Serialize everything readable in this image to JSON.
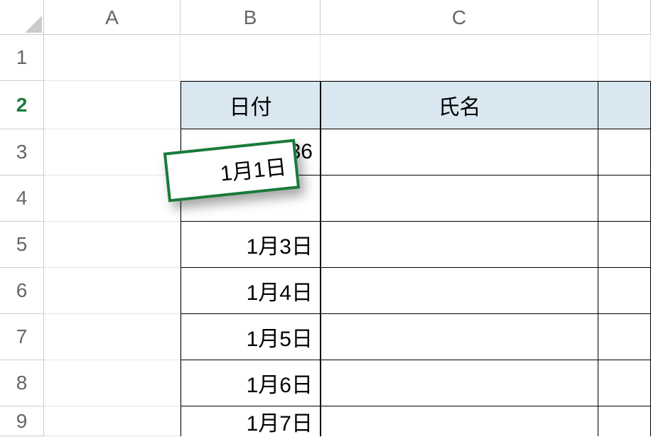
{
  "columns": [
    "A",
    "B",
    "C"
  ],
  "rows": [
    "1",
    "2",
    "3",
    "4",
    "5",
    "6",
    "7",
    "8",
    "9"
  ],
  "active_row_index": 1,
  "table": {
    "headers": {
      "b": "日付",
      "c": "氏名"
    },
    "b_values": [
      "42736",
      "",
      "1月3日",
      "1月4日",
      "1月5日",
      "1月6日",
      "1月7日"
    ]
  },
  "floating_value": "1月1日"
}
